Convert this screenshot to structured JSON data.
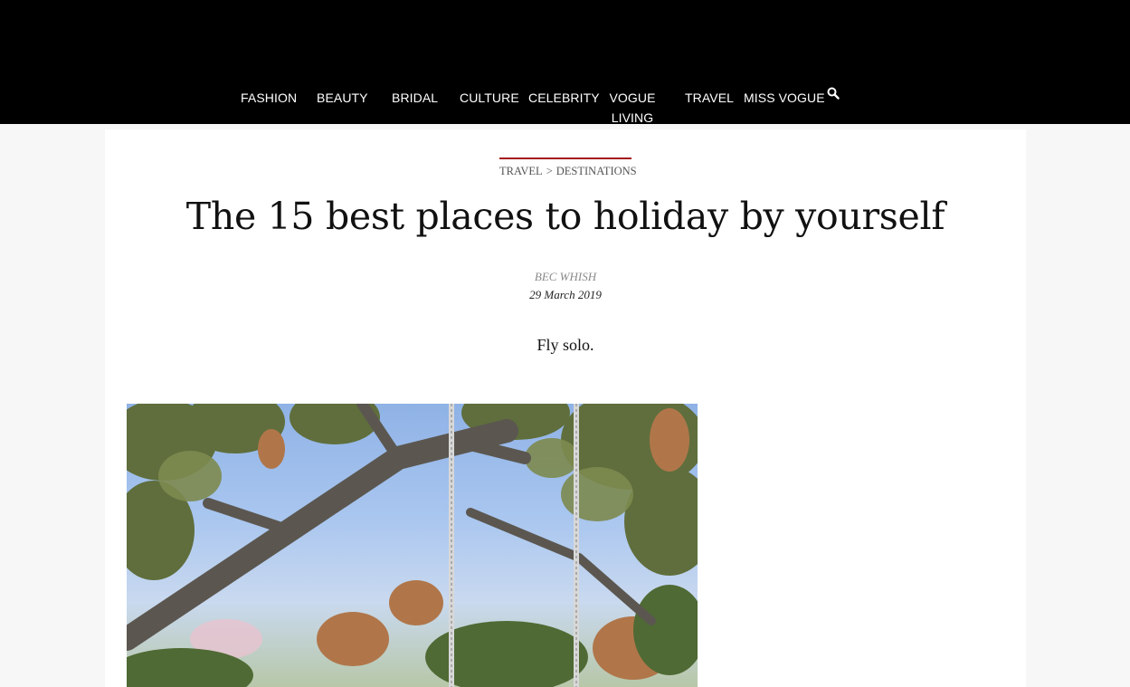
{
  "nav": {
    "items": [
      {
        "label": "FASHION"
      },
      {
        "label": "BEAUTY"
      },
      {
        "label": "BRIDAL"
      },
      {
        "label": "CULTURE"
      },
      {
        "label": "CELEBRITY"
      },
      {
        "label": "VOGUE LIVING"
      },
      {
        "label": "TRAVEL"
      },
      {
        "label": "MISS VOGUE"
      }
    ],
    "search_icon": "search-icon"
  },
  "article": {
    "breadcrumb": {
      "section": "TRAVEL",
      "separator": ">",
      "subsection": "DESTINATIONS"
    },
    "title": "The 15 best places to holiday by yourself",
    "author": "BEC WHISH",
    "date": "29 March 2019",
    "standfirst": "Fly solo."
  },
  "colors": {
    "header_bg": "#000000",
    "accent": "#a3161c",
    "page_bg": "#f7f7f7"
  }
}
